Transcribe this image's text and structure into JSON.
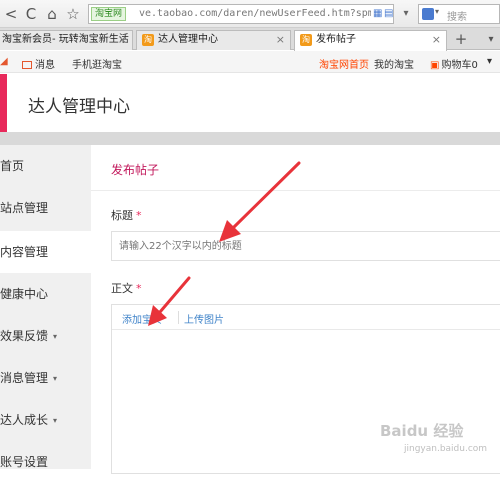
{
  "browser": {
    "back_label": "<",
    "reload_label": "C",
    "home_label": "⌂",
    "star_label": "☆",
    "secure_badge": "淘宝网",
    "url": "ve.taobao.com/daren/newUserFeed.htm?spm=a",
    "dropdown": "▾",
    "search_placeholder": "搜索"
  },
  "tabs": [
    {
      "label": "淘宝新会员- 玩转淘宝新生活",
      "close": "×"
    },
    {
      "label": "达人管理中心",
      "close": "×"
    },
    {
      "label": "发布帖子",
      "close": "×"
    }
  ],
  "new_tab": "+",
  "tab_menu": "▾",
  "sitebar": {
    "messages": "消息",
    "mobile": "手机逛淘宝",
    "home": "淘宝网首页",
    "my_taobao": "我的淘宝",
    "cart": "购物车0",
    "more": "▾"
  },
  "header": {
    "title": "达人管理中心",
    "accent_color": "#e8295b"
  },
  "sidebar": {
    "items": [
      {
        "label": "首页",
        "caret": ""
      },
      {
        "label": "站点管理",
        "caret": ""
      },
      {
        "label": "内容管理",
        "caret": ""
      },
      {
        "label": "健康中心",
        "caret": ""
      },
      {
        "label": "效果反馈",
        "caret": "▾"
      },
      {
        "label": "消息管理",
        "caret": "▾"
      },
      {
        "label": "达人成长",
        "caret": "▾"
      },
      {
        "label": "账号设置",
        "caret": ""
      }
    ]
  },
  "main": {
    "page_title": "发布帖子",
    "title_label": "标题",
    "required_mark": "*",
    "title_placeholder": "请输入22个汉字以内的标题",
    "body_label": "正文",
    "add_item": "添加宝贝",
    "upload_image": "上传图片"
  },
  "watermark": {
    "text": "Baidu 经验",
    "sub": "jingyan.baidu.com"
  }
}
